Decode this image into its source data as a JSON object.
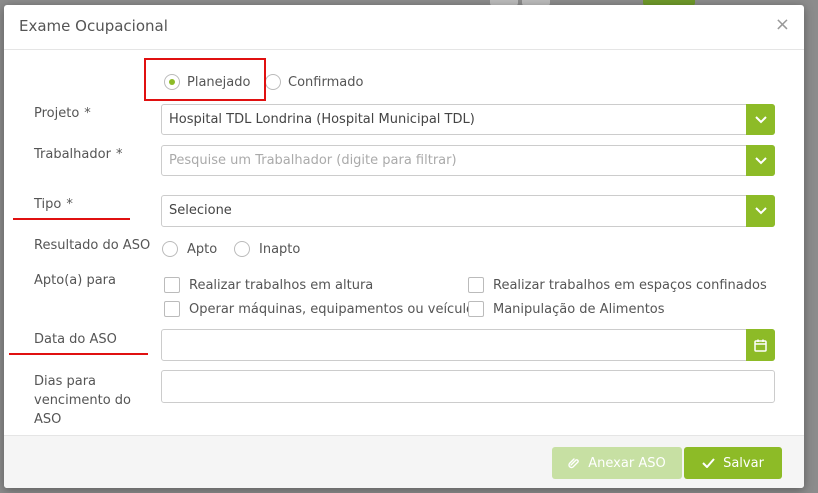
{
  "modal": {
    "title": "Exame Ocupacional",
    "close_label": "×"
  },
  "status": {
    "options": [
      {
        "label": "Planejado",
        "checked": true
      },
      {
        "label": "Confirmado",
        "checked": false
      }
    ]
  },
  "form": {
    "projeto": {
      "label": "Projeto",
      "required": "*",
      "value": "Hospital TDL Londrina (Hospital Municipal TDL)"
    },
    "trabalhador": {
      "label": "Trabalhador",
      "required": "*",
      "placeholder": "Pesquise um Trabalhador (digite para filtrar)"
    },
    "tipo": {
      "label": "Tipo",
      "required": "*",
      "value": "Selecione"
    },
    "resultado": {
      "label": "Resultado do ASO",
      "options": [
        {
          "label": "Apto"
        },
        {
          "label": "Inapto"
        }
      ]
    },
    "apto_para": {
      "label": "Apto(a) para",
      "options": [
        {
          "label": "Realizar trabalhos em altura"
        },
        {
          "label": "Realizar trabalhos em espaços confinados"
        },
        {
          "label": "Operar máquinas, equipamentos ou veículos"
        },
        {
          "label": "Manipulação de Alimentos"
        }
      ]
    },
    "data_aso": {
      "label": "Data do ASO",
      "value": ""
    },
    "dias_vencimento": {
      "label_lines": [
        "Dias para",
        "vencimento do",
        "ASO"
      ],
      "value": ""
    }
  },
  "footer": {
    "attach_label": "Anexar ASO",
    "save_label": "Salvar"
  },
  "colors": {
    "accent": "#8dbb27",
    "accent_disabled": "#c7e0a3",
    "highlight": "#e01010"
  }
}
